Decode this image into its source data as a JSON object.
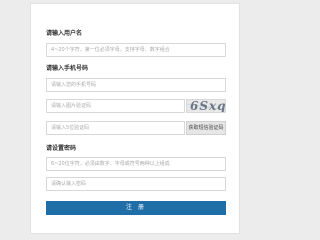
{
  "username": {
    "label": "请输入用户名",
    "placeholder": "4~20个字符，第一位必须字母，支持字母、数字组合"
  },
  "phone": {
    "label": "请输入手机号码",
    "placeholder": "请输入您的手机号码"
  },
  "image_code": {
    "placeholder": "请输入图片验证码",
    "captcha_text": "6Sxq"
  },
  "sms_code": {
    "placeholder": "请输入5位验证码",
    "button_label": "获取短信验证码"
  },
  "password": {
    "label": "请设置密码",
    "placeholder": "6~20位字符，必须由数字、字母或符号两种以上组成",
    "confirm_placeholder": "请确认输入密码"
  },
  "register_button": {
    "label": "注 册"
  },
  "colors": {
    "primary": "#1f6ea8",
    "background": "#ececec"
  }
}
